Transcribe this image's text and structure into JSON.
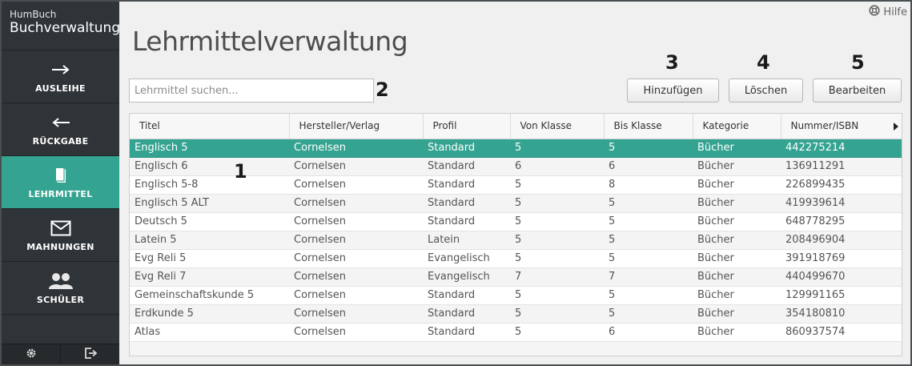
{
  "brand": {
    "small": "HumBuch",
    "big": "Buchverwaltung"
  },
  "nav": [
    {
      "label": "AUSLEIHE",
      "icon": "arrow-right-icon",
      "active": false
    },
    {
      "label": "RÜCKGABE",
      "icon": "arrow-left-icon",
      "active": false
    },
    {
      "label": "LEHRMITTEL",
      "icon": "book-icon",
      "active": true
    },
    {
      "label": "MAHNUNGEN",
      "icon": "envelope-icon",
      "active": false
    },
    {
      "label": "SCHÜLER",
      "icon": "users-icon",
      "active": false
    }
  ],
  "footer": {
    "left_icon": "gear-icon",
    "right_icon": "logout-icon"
  },
  "help_label": "Hilfe",
  "page_title": "Lehrmittelverwaltung",
  "search": {
    "placeholder": "Lehrmittel suchen...",
    "value": ""
  },
  "buttons": {
    "add": "Hinzufügen",
    "delete": "Löschen",
    "edit": "Bearbeiten"
  },
  "annotations": {
    "table": "1",
    "search": "2",
    "add": "3",
    "delete": "4",
    "edit": "5"
  },
  "table": {
    "columns": [
      "Titel",
      "Hersteller/Verlag",
      "Profil",
      "Von Klasse",
      "Bis Klasse",
      "Kategorie",
      "Nummer/ISBN"
    ],
    "rows": [
      [
        "Englisch 5",
        "Cornelsen",
        "Standard",
        "5",
        "5",
        "Bücher",
        "442275214"
      ],
      [
        "Englisch 6",
        "Cornelsen",
        "Standard",
        "6",
        "6",
        "Bücher",
        "136911291"
      ],
      [
        "Englisch 5-8",
        "Cornelsen",
        "Standard",
        "5",
        "8",
        "Bücher",
        "226899435"
      ],
      [
        "Englisch 5 ALT",
        "Cornelsen",
        "Standard",
        "5",
        "5",
        "Bücher",
        "419939614"
      ],
      [
        "Deutsch 5",
        "Cornelsen",
        "Standard",
        "5",
        "5",
        "Bücher",
        "648778295"
      ],
      [
        "Latein 5",
        "Cornelsen",
        "Latein",
        "5",
        "5",
        "Bücher",
        "208496904"
      ],
      [
        "Evg Reli 5",
        "Cornelsen",
        "Evangelisch",
        "5",
        "5",
        "Bücher",
        "391918769"
      ],
      [
        "Evg Reli 7",
        "Cornelsen",
        "Evangelisch",
        "7",
        "7",
        "Bücher",
        "440499670"
      ],
      [
        "Gemeinschaftskunde 5",
        "Cornelsen",
        "Standard",
        "5",
        "5",
        "Bücher",
        "129991165"
      ],
      [
        "Erdkunde 5",
        "Cornelsen",
        "Standard",
        "5",
        "5",
        "Bücher",
        "354180810"
      ],
      [
        "Atlas",
        "Cornelsen",
        "Standard",
        "5",
        "6",
        "Bücher",
        "860937574"
      ]
    ],
    "selected_row": 0
  },
  "colors": {
    "accent": "#35a391",
    "sidebar": "#2f3438"
  }
}
